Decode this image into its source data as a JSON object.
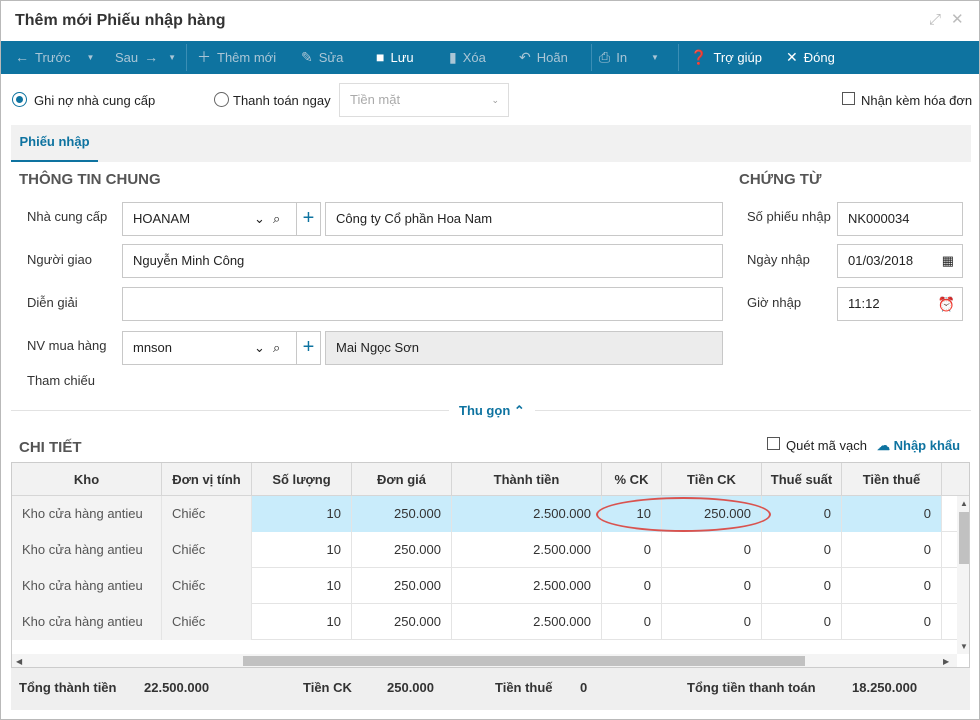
{
  "window": {
    "title": "Thêm mới Phiếu nhập hàng"
  },
  "toolbar": {
    "prev": "Trước",
    "next": "Sau",
    "add": "Thêm mới",
    "edit": "Sửa",
    "save": "Lưu",
    "delete": "Xóa",
    "undo": "Hoãn",
    "print": "In",
    "help": "Trợ giúp",
    "close": "Đóng"
  },
  "payment": {
    "debt_label": "Ghi nợ nhà cung cấp",
    "pay_now_label": "Thanh toán ngay",
    "method_placeholder": "Tiền mặt",
    "invoice_label": "Nhận kèm hóa đơn"
  },
  "tabs": {
    "receipt": "Phiếu nhập"
  },
  "general": {
    "heading": "THÔNG TIN CHUNG",
    "supplier_label": "Nhà cung cấp",
    "supplier_code": "HOANAM",
    "supplier_name": "Công ty Cổ phần Hoa Nam",
    "deliverer_label": "Người giao",
    "deliverer": "Nguyễn Minh Công",
    "description_label": "Diễn giải",
    "description": "",
    "buyer_label": "NV mua hàng",
    "buyer_code": "mnson",
    "buyer_name": "Mai Ngọc Sơn",
    "reference_label": "Tham chiếu"
  },
  "voucher": {
    "heading": "CHỨNG TỪ",
    "number_label": "Số phiếu nhập",
    "number": "NK000034",
    "date_label": "Ngày nhập",
    "date": "01/03/2018",
    "time_label": "Giờ nhập",
    "time": "11:12"
  },
  "collapse_label": "Thu gọn",
  "detail": {
    "heading": "CHI TIẾT",
    "scan_label": "Quét mã vạch",
    "import_label": "Nhập khẩu",
    "columns": [
      "Kho",
      "Đơn vị tính",
      "Số lượng",
      "Đơn giá",
      "Thành tiền",
      "% CK",
      "Tiền CK",
      "Thuế suất",
      "Tiền thuế"
    ],
    "rows": [
      [
        "Kho cửa hàng antieu",
        "Chiếc",
        "10",
        "250.000",
        "2.500.000",
        "10",
        "250.000",
        "0",
        "0"
      ],
      [
        "Kho cửa hàng antieu",
        "Chiếc",
        "10",
        "250.000",
        "2.500.000",
        "0",
        "0",
        "0",
        "0"
      ],
      [
        "Kho cửa hàng antieu",
        "Chiếc",
        "10",
        "250.000",
        "2.500.000",
        "0",
        "0",
        "0",
        "0"
      ],
      [
        "Kho cửa hàng antieu",
        "Chiếc",
        "10",
        "250.000",
        "2.500.000",
        "0",
        "0",
        "0",
        "0"
      ]
    ]
  },
  "totals": {
    "subtotal_label": "Tổng thành tiền",
    "subtotal": "22.500.000",
    "discount_label": "Tiền CK",
    "discount": "250.000",
    "tax_label": "Tiền thuế",
    "tax": "0",
    "total_label": "Tổng tiền thanh toán",
    "total": "18.250.000"
  },
  "colors": {
    "accent": "#0e73a0",
    "selected_row": "#c9ecfb",
    "highlight": "#d9534f"
  }
}
